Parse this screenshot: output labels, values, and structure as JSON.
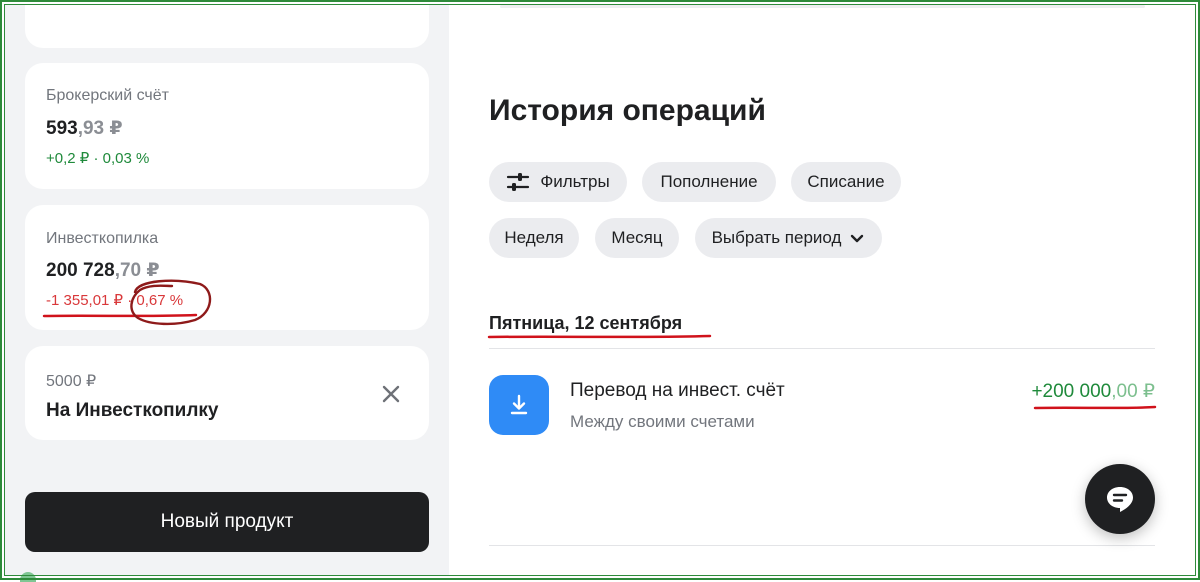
{
  "accounts": {
    "broker": {
      "label": "Брокерский счёт",
      "amount_int": "593",
      "amount_frac": ",93 ₽",
      "change": "+0,2 ₽ · 0,03 %",
      "change_color": "#1f8a3b"
    },
    "investkopilka": {
      "label": "Инвесткопилка",
      "amount_int": "200 728",
      "amount_frac": ",70 ₽",
      "change": "-1 355,01 ₽ · 0,67 %",
      "change_color": "#d9383a"
    },
    "goal": {
      "amount": "5000 ₽",
      "title": "На Инвесткопилку",
      "close_icon": "close-icon"
    }
  },
  "new_product_button": "Новый продукт",
  "history": {
    "title": "История операций",
    "chips_row1": [
      {
        "label": "Фильтры",
        "icon": "filter-sliders-icon"
      },
      {
        "label": "Пополнение"
      },
      {
        "label": "Списание"
      }
    ],
    "chips_row2": [
      {
        "label": "Неделя"
      },
      {
        "label": "Месяц"
      },
      {
        "label": "Выбрать период",
        "icon": "chevron-down-icon"
      }
    ],
    "day": "Пятница, 12 сентября",
    "operations": [
      {
        "title": "Перевод на инвест. счёт",
        "subtitle": "Между своими счетами",
        "amount_int": "+200 000",
        "amount_frac": ",00 ₽",
        "icon": "download-arrow-icon",
        "icon_color": "#2f8bf6"
      }
    ]
  },
  "chat_button_icon": "chat-icon",
  "colors": {
    "positive": "#1f8a3b",
    "negative": "#d9383a",
    "annotation": "#d0121b",
    "frame": "#2e8b3a",
    "dark": "#1f2022",
    "chip_bg": "#ebecef",
    "sidebar_bg": "#f2f3f5"
  }
}
